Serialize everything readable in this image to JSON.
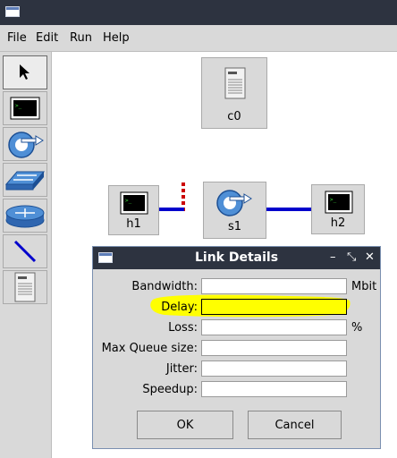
{
  "menu": {
    "file": "File",
    "edit": "Edit",
    "run": "Run",
    "help": "Help"
  },
  "tools": [
    "select-pointer",
    "host",
    "switch",
    "legacy-switch",
    "router",
    "link",
    "controller"
  ],
  "nodes": {
    "c0": "c0",
    "h1": "h1",
    "s1": "s1",
    "h2": "h2"
  },
  "colors": {
    "link": "#0000cc",
    "control_link": "#cc0000",
    "highlight": "#ffff00",
    "titlebar": "#2d3340",
    "panel": "#d9d9d9"
  },
  "dialog": {
    "title": "Link Details",
    "controls": {
      "minimize": "–",
      "restore": "⤡",
      "close": "✕"
    },
    "fields": [
      {
        "label": "Bandwidth:",
        "value": "",
        "unit": "Mbit"
      },
      {
        "label": "Delay:",
        "value": "",
        "unit": ""
      },
      {
        "label": "Loss:",
        "value": "",
        "unit": "%"
      },
      {
        "label": "Max Queue size:",
        "value": "",
        "unit": ""
      },
      {
        "label": "Jitter:",
        "value": "",
        "unit": ""
      },
      {
        "label": "Speedup:",
        "value": "",
        "unit": ""
      }
    ],
    "ok": "OK",
    "cancel": "Cancel"
  }
}
